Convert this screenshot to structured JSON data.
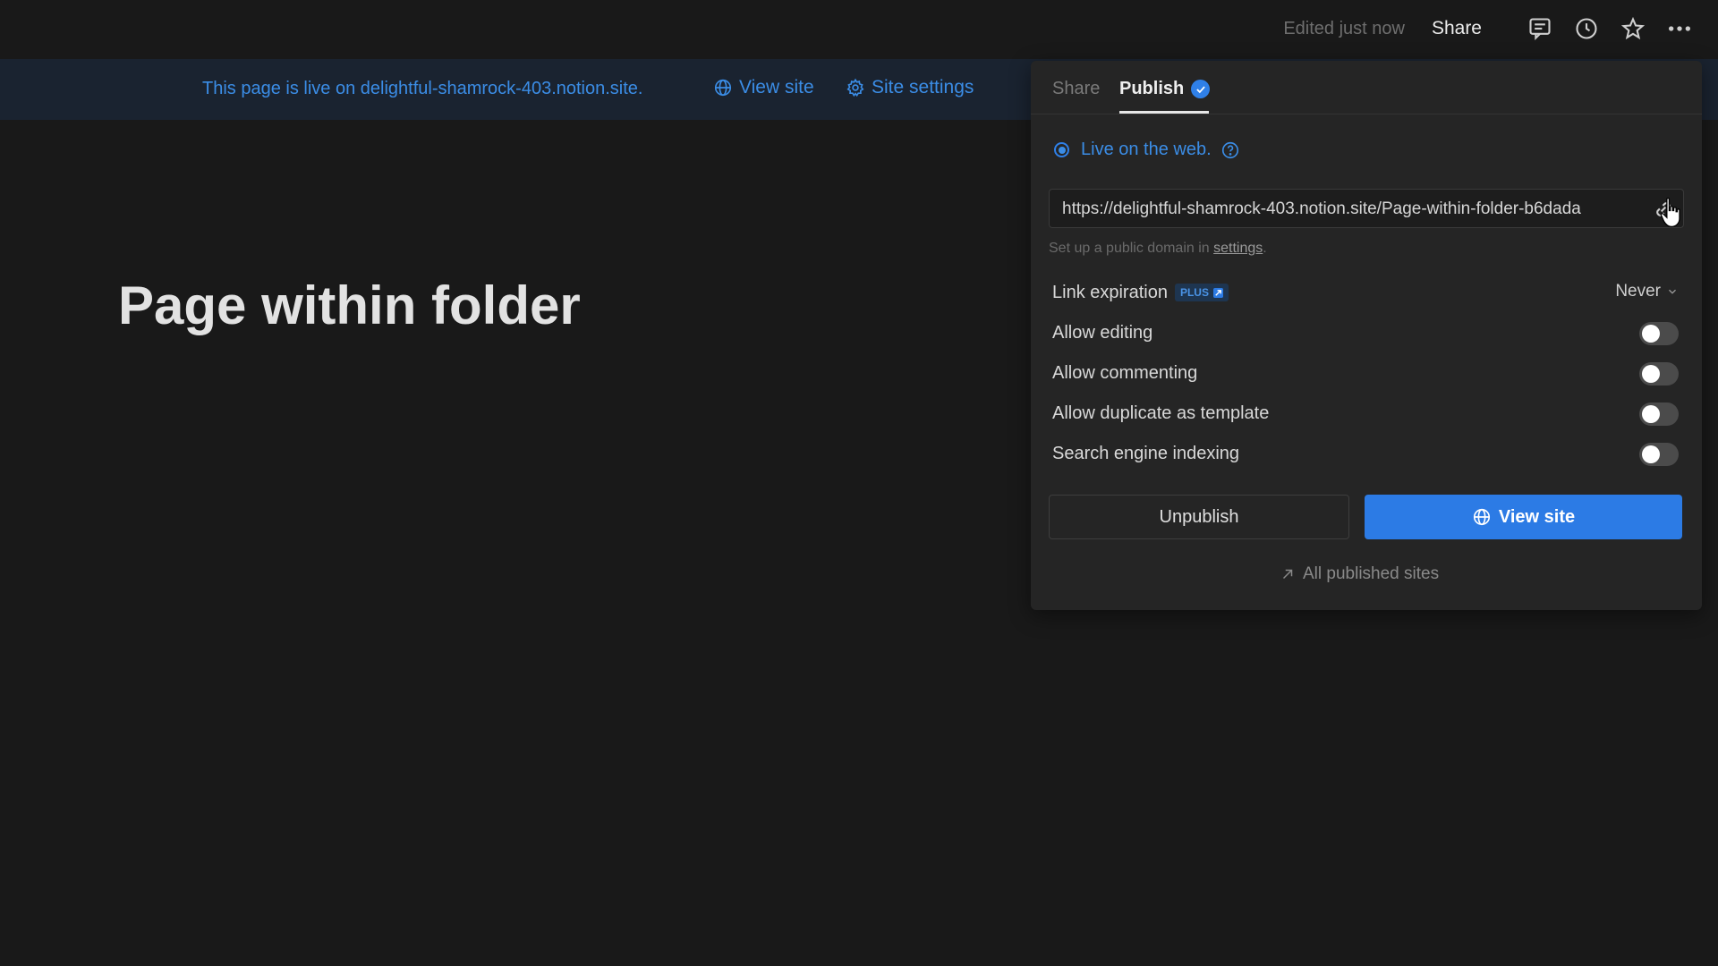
{
  "topbar": {
    "edited": "Edited just now",
    "share_label": "Share",
    "icons": [
      "comment-icon",
      "history-icon",
      "star-icon",
      "more-icon"
    ]
  },
  "banner": {
    "message": "This page is live on delightful-shamrock-403.notion.site.",
    "view_site": "View site",
    "site_settings": "Site settings"
  },
  "page": {
    "title": "Page within folder"
  },
  "panel": {
    "tabs": [
      {
        "label": "Share",
        "active": false
      },
      {
        "label": "Publish",
        "active": true
      }
    ],
    "live_label": "Live on the web.",
    "url": "https://delightful-shamrock-403.notion.site/Page-within-folder-b6dada",
    "domain_hint_prefix": "Set up a public domain in ",
    "domain_hint_link": "settings",
    "domain_hint_suffix": ".",
    "link_expiration": {
      "label": "Link expiration",
      "badge": "PLUS",
      "value": "Never"
    },
    "options": [
      {
        "label": "Allow editing",
        "enabled": false
      },
      {
        "label": "Allow commenting",
        "enabled": false
      },
      {
        "label": "Allow duplicate as template",
        "enabled": false
      },
      {
        "label": "Search engine indexing",
        "enabled": false
      }
    ],
    "unpublish_label": "Unpublish",
    "view_site_label": "View site",
    "all_sites_label": "All published sites"
  },
  "colors": {
    "accent": "#2c7be5",
    "link": "#3b8de6",
    "background": "#191919",
    "panel": "#252525"
  }
}
